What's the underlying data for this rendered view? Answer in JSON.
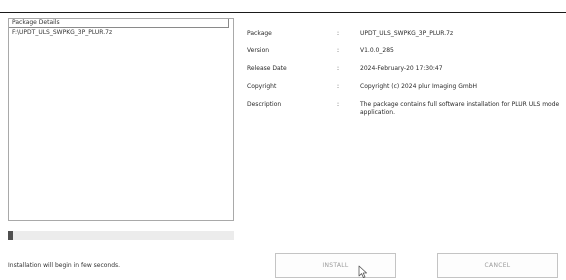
{
  "package_panel": {
    "header": "Package Details",
    "items": [
      "F:\\UPDT_ULS_SWPKG_3P_PLUR.7z"
    ]
  },
  "details": [
    {
      "label": "Package",
      "value": "UPDT_ULS_SWPKG_3P_PLUR.7z"
    },
    {
      "label": "Version",
      "value": "V1.0.0_285"
    },
    {
      "label": "Release Date",
      "value": "2024-February-20 17:30:47"
    },
    {
      "label": "Copyright",
      "value": "Copyright (c) 2024 plur Imaging GmbH"
    },
    {
      "label": "Description",
      "value": "The package contains full software installation for PLUR ULS mode application."
    }
  ],
  "separator": ":",
  "progress": {
    "fraction": 0.02
  },
  "status_text": "Installation will begin in few seconds.",
  "buttons": {
    "install": "INSTALL",
    "cancel": "CANCEL"
  },
  "colors": {
    "progress_fill": "#4f4f4f",
    "button_text_disabled": "#9a9a9a"
  },
  "icons": {
    "cursor": "arrow-cursor-icon"
  }
}
